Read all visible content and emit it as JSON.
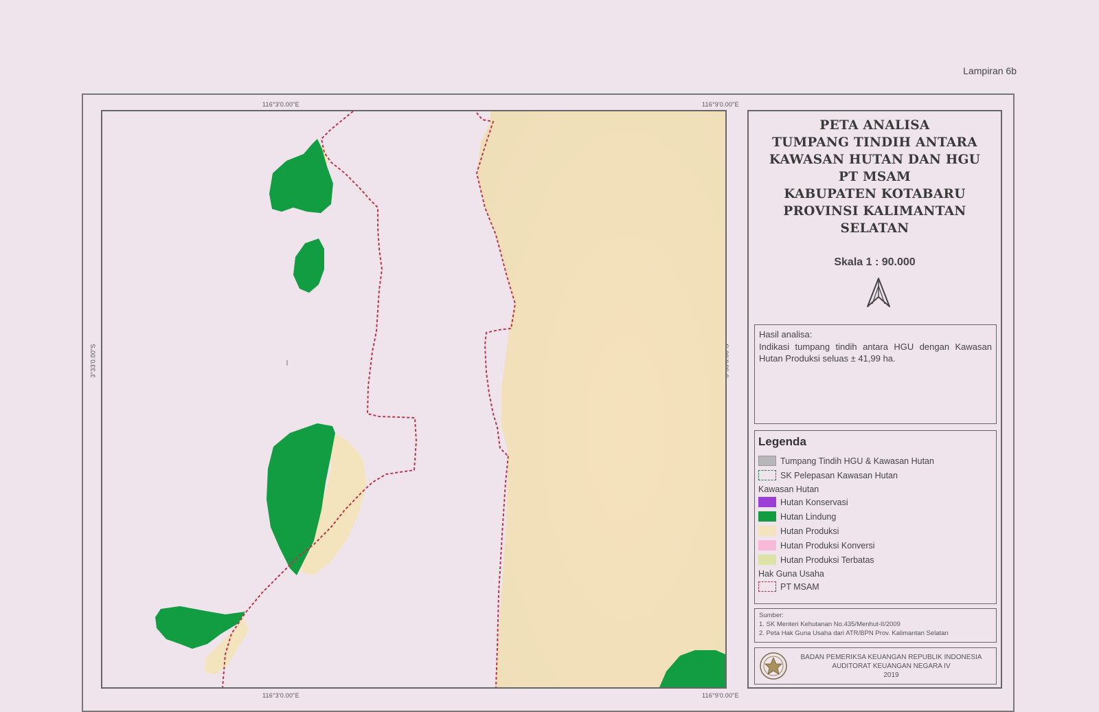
{
  "header": {
    "attachment_label": "Lampiran 6b"
  },
  "coordinates": {
    "top_left": "116°3'0.00\"E",
    "top_right": "116°9'0.00\"E",
    "bottom_left": "116°3'0.00\"E",
    "bottom_right": "116°9'0.00\"E",
    "left_mid": "3°33'0.00\"S",
    "right_mid": "3°33'0.00\"S"
  },
  "title_lines": [
    "PETA ANALISA",
    "TUMPANG TINDIH ANTARA",
    "KAWASAN HUTAN DAN HGU",
    "PT MSAM",
    "KABUPATEN KOTABARU",
    "PROVINSI KALIMANTAN",
    "SELATAN"
  ],
  "scale": "Skala 1 : 90.000",
  "analysis": {
    "title": "Hasil analisa:",
    "text": "Indikasi tumpang tindih antara HGU dengan Kawasan Hutan Produksi seluas ± 41,99 ha."
  },
  "legend": {
    "title": "Legenda",
    "overlap": "Tumpang Tindih HGU & Kawasan Hutan",
    "sk_release": "SK Pelepasan Kawasan Hutan",
    "group_forest": "Kawasan Hutan",
    "forest_items": [
      {
        "label": "Hutan Konservasi",
        "color": "#9b3fd6"
      },
      {
        "label": "Hutan Lindung",
        "color": "#139d42"
      },
      {
        "label": "Hutan Produksi",
        "color": "#f4e4bd"
      },
      {
        "label": "Hutan Produksi Konversi",
        "color": "#f8b9d9"
      },
      {
        "label": "Hutan Produksi Terbatas",
        "color": "#dde3a6"
      }
    ],
    "group_hgu": "Hak Guna Usaha",
    "hgu_item": "PT MSAM"
  },
  "sources": {
    "title": "Sumber:",
    "items": [
      "1. SK Menteri Kehutanan No.435/Menhut-II/2009",
      "2. Peta Hak Guna Usaha dari ATR/BPN Prov. Kalimantan Selatan"
    ]
  },
  "agency": {
    "line1": "BADAN PEMERIKSA KEUANGAN REPUBLIK INDONESIA",
    "line2": "AUDITORAT KEUANGAN NEGARA IV",
    "year": "2019"
  },
  "colors": {
    "background": "#efe4ec",
    "hutan_lindung": "#139d42",
    "hutan_produksi": "#f4e4bd",
    "hgu_boundary": "#c0334a",
    "overlap_swatch": "#b9b6ba"
  }
}
